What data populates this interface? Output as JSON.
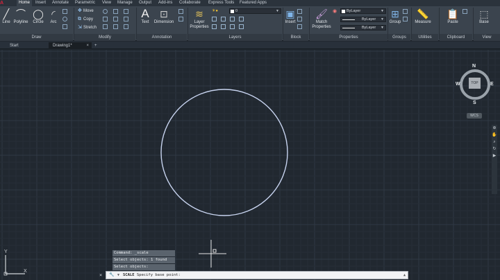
{
  "menu_tabs": [
    "Home",
    "Insert",
    "Annotate",
    "Parametric",
    "View",
    "Manage",
    "Output",
    "Add-ins",
    "Collaborate",
    "Express Tools",
    "Featured Apps"
  ],
  "ribbon": {
    "draw": {
      "line": "Line",
      "polyline": "Polyline",
      "circle": "Circle",
      "arc": "Arc",
      "label": "Draw"
    },
    "modify": {
      "move": "Move",
      "copy": "Copy",
      "stretch": "Stretch",
      "label": "Modify"
    },
    "annotation": {
      "text": "Text",
      "dimension": "Dimension",
      "label": "Annotation"
    },
    "layers": {
      "layer_properties": "Layer\nProperties",
      "layer_value": "0",
      "label": "Layers"
    },
    "block": {
      "insert": "Insert",
      "label": "Block"
    },
    "properties": {
      "match": "Match\nProperties",
      "color": "ByLayer",
      "linetype": "ByLayer",
      "lineweight": "ByLayer",
      "label": "Properties"
    },
    "groups": {
      "group": "Group",
      "label": "Groups"
    },
    "utilities": {
      "measure": "Measure",
      "label": "Utilities"
    },
    "clipboard": {
      "paste": "Paste",
      "label": "Clipboard"
    },
    "view": {
      "base": "Base",
      "label": "View"
    }
  },
  "doc_tabs": {
    "start": "Start",
    "drawing": "Drawing1*",
    "add": "+"
  },
  "viewcube": {
    "n": "N",
    "s": "S",
    "e": "E",
    "w": "W",
    "top": "TOP",
    "wcs": "WCS"
  },
  "command": {
    "history": [
      "Command: _scale",
      "Select objects: 1 found",
      "Select objects:"
    ],
    "current_command": "SCALE",
    "prompt": "Specify base point:"
  },
  "ucs": {
    "x": "X",
    "y": "Y"
  },
  "colors": {
    "background": "#212830",
    "circle": "#c8d4f0",
    "ribbon": "#3b444e",
    "accent": "#1f6fc6"
  }
}
